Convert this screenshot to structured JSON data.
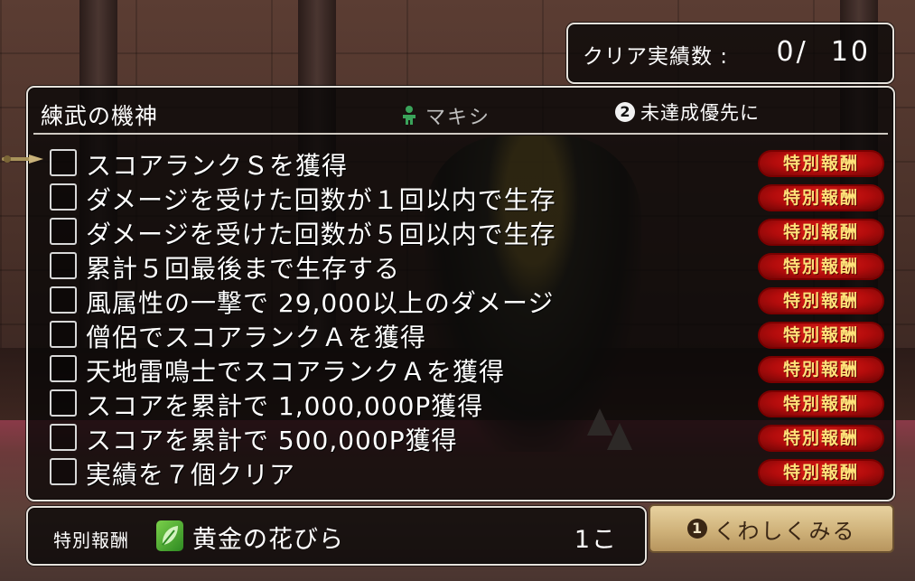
{
  "header": {
    "clear_count_label": "クリア実績数 :",
    "clear_count_value": "0/  10"
  },
  "panel": {
    "title": "練武の機神",
    "character_name": "マキシ",
    "character_icon": "person-icon",
    "sort_button_number": "2",
    "sort_button_label": "未達成優先に"
  },
  "achievements": [
    {
      "label": "スコアランクＳを獲得",
      "reward_badge": "特別報酬",
      "completed": false
    },
    {
      "label": "ダメージを受けた回数が１回以内で生存",
      "reward_badge": "特別報酬",
      "completed": false
    },
    {
      "label": "ダメージを受けた回数が５回以内で生存",
      "reward_badge": "特別報酬",
      "completed": false
    },
    {
      "label": "累計５回最後まで生存する",
      "reward_badge": "特別報酬",
      "completed": false
    },
    {
      "label": "風属性の一撃で 29,000以上のダメージ",
      "reward_badge": "特別報酬",
      "completed": false
    },
    {
      "label": "僧侶でスコアランクＡを獲得",
      "reward_badge": "特別報酬",
      "completed": false
    },
    {
      "label": "天地雷鳴士でスコアランクＡを獲得",
      "reward_badge": "特別報酬",
      "completed": false
    },
    {
      "label": "スコアを累計で 1,000,000P獲得",
      "reward_badge": "特別報酬",
      "completed": false
    },
    {
      "label": "スコアを累計で 500,000P獲得",
      "reward_badge": "特別報酬",
      "completed": false
    },
    {
      "label": "実績を７個クリア",
      "reward_badge": "特別報酬",
      "completed": false
    }
  ],
  "reward": {
    "label": "特別報酬",
    "icon": "leaf-icon",
    "item_name": "黄金の花びら",
    "count": "1こ"
  },
  "detail_button": {
    "number": "1",
    "label": "くわしくみる"
  },
  "colors": {
    "badge_red": "#c8140f",
    "badge_text": "#ffe27a",
    "panel_border": "#e6e2dc"
  }
}
